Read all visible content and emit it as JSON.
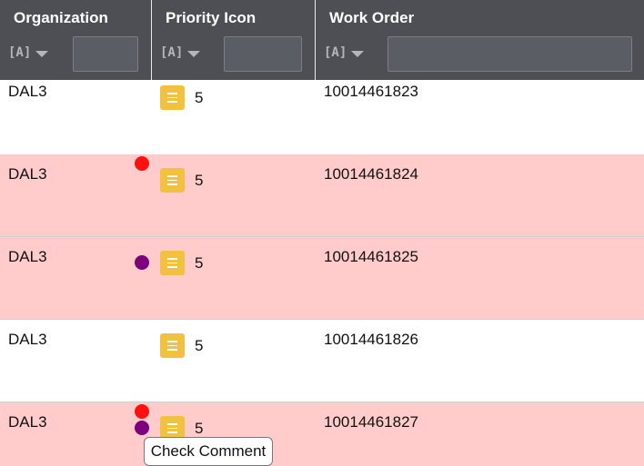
{
  "columns": {
    "organization": "Organization",
    "priority_icon": "Priority Icon",
    "work_order": "Work Order"
  },
  "filter": {
    "type_glyph": "[A]",
    "caret_icon": "caret-down-icon",
    "placeholder": ""
  },
  "rows": [
    {
      "organization": "DAL3",
      "priority": "5",
      "work_order": "10014461823",
      "highlight": false,
      "indicators": []
    },
    {
      "organization": "DAL3",
      "priority": "5",
      "work_order": "10014461824",
      "highlight": true,
      "indicators": [
        "red"
      ]
    },
    {
      "organization": "DAL3",
      "priority": "5",
      "work_order": "10014461825",
      "highlight": true,
      "indicators": [
        "purple"
      ]
    },
    {
      "organization": "DAL3",
      "priority": "5",
      "work_order": "10014461826",
      "highlight": false,
      "indicators": []
    },
    {
      "organization": "DAL3",
      "priority": "5",
      "work_order": "10014461827",
      "highlight": true,
      "indicators": [
        "red",
        "purple"
      ]
    }
  ],
  "colors": {
    "header_bg": "#4d4f55",
    "row_alert_bg": "#ffcccb",
    "priority_icon": "#f2c13f",
    "indicator_red": "#ff1010",
    "indicator_purple": "#7d007d"
  },
  "tooltip": {
    "text": "Check Comment"
  }
}
